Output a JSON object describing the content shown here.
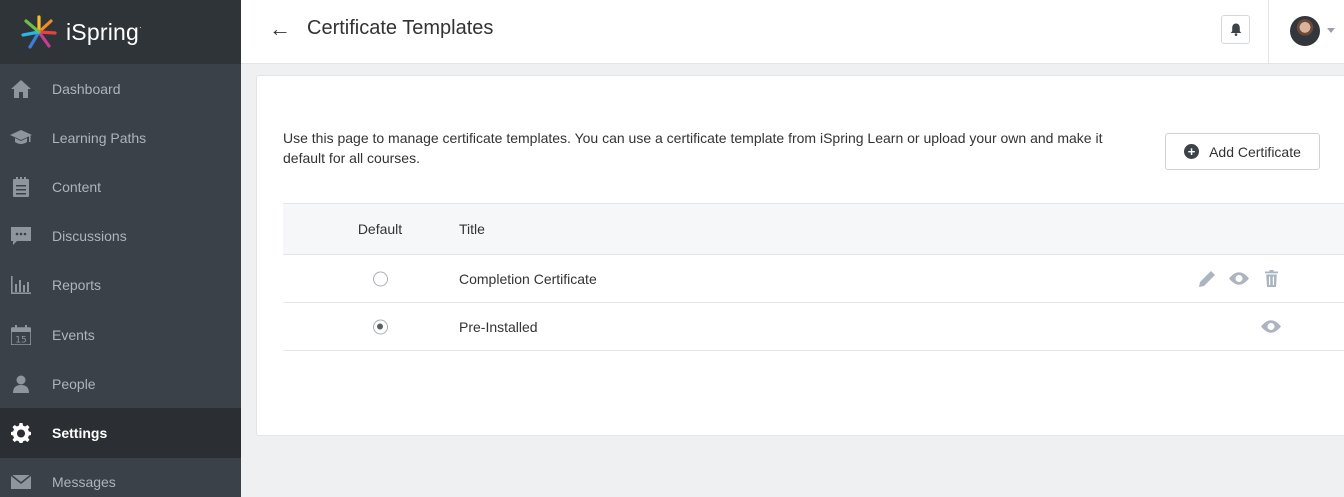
{
  "brand": {
    "name": "iSpring",
    "mark": "·"
  },
  "sidebar": {
    "items": [
      {
        "label": "Dashboard",
        "icon": "home-icon"
      },
      {
        "label": "Learning Paths",
        "icon": "graduation-cap-icon"
      },
      {
        "label": "Content",
        "icon": "content-icon"
      },
      {
        "label": "Discussions",
        "icon": "chat-icon"
      },
      {
        "label": "Reports",
        "icon": "bar-chart-icon"
      },
      {
        "label": "Events",
        "icon": "calendar-icon",
        "calendar_day": "15"
      },
      {
        "label": "People",
        "icon": "person-icon"
      },
      {
        "label": "Settings",
        "icon": "gear-icon",
        "active": true
      },
      {
        "label": "Messages",
        "icon": "envelope-icon"
      }
    ]
  },
  "header": {
    "back": "←",
    "title": "Certificate Templates"
  },
  "main": {
    "description": "Use this page to manage certificate templates. You can use a certificate template from iSpring Learn or upload your own and make it default for all courses.",
    "add_button": "Add Certificate",
    "table": {
      "columns": [
        "Default",
        "Title"
      ],
      "rows": [
        {
          "title": "Completion Certificate",
          "default": false,
          "actions": [
            "edit",
            "preview",
            "delete"
          ]
        },
        {
          "title": "Pre-Installed",
          "default": true,
          "actions": [
            "preview"
          ]
        }
      ]
    }
  },
  "colors": {
    "sidebar_bg": "#3b4148",
    "sidebar_active": "#2b2f34",
    "action_icon": "#aab5c0"
  }
}
